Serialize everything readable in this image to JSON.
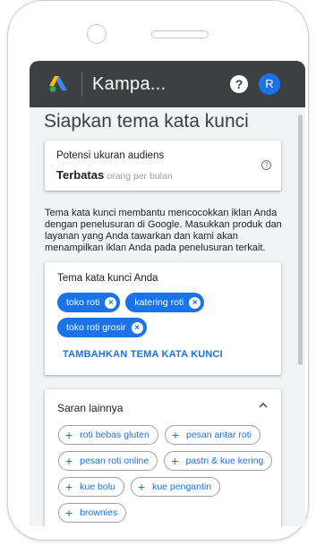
{
  "app_bar": {
    "title": "Kampa...",
    "help_label": "?",
    "avatar_initial": "R",
    "bar_color": "#3c4043"
  },
  "page": {
    "title": "Siapkan tema kata kunci"
  },
  "audience": {
    "label": "Potensi ukuran audiens",
    "value": "Terbatas",
    "unit": "orang per bulan",
    "help_icon": "?"
  },
  "description": "Tema kata kunci membantu mencocokkan iklan Anda dengan penelusuran di Google. Masukkan produk dan layanan yang Anda tawarkan dan kami akan menampilkan iklan Anda pada penelusuran terkait.",
  "keywords": {
    "title": "Tema kata kunci Anda",
    "chips": [
      {
        "label": "toko roti"
      },
      {
        "label": "katering roti"
      },
      {
        "label": "toko roti grosir"
      }
    ],
    "add_label": "TAMBAHKAN TEMA KATA KUNCI"
  },
  "suggestions": {
    "title": "Saran lainnya",
    "chips": [
      {
        "label": "roti bebas gluten"
      },
      {
        "label": "pesan antar roti"
      },
      {
        "label": "pesan roti online"
      },
      {
        "label": "pastri & kue kering"
      },
      {
        "label": "kue bolu"
      },
      {
        "label": "kue pengantin"
      },
      {
        "label": "brownies"
      }
    ]
  },
  "colors": {
    "accent": "#1a73e8",
    "background": "#f1f3f4"
  }
}
